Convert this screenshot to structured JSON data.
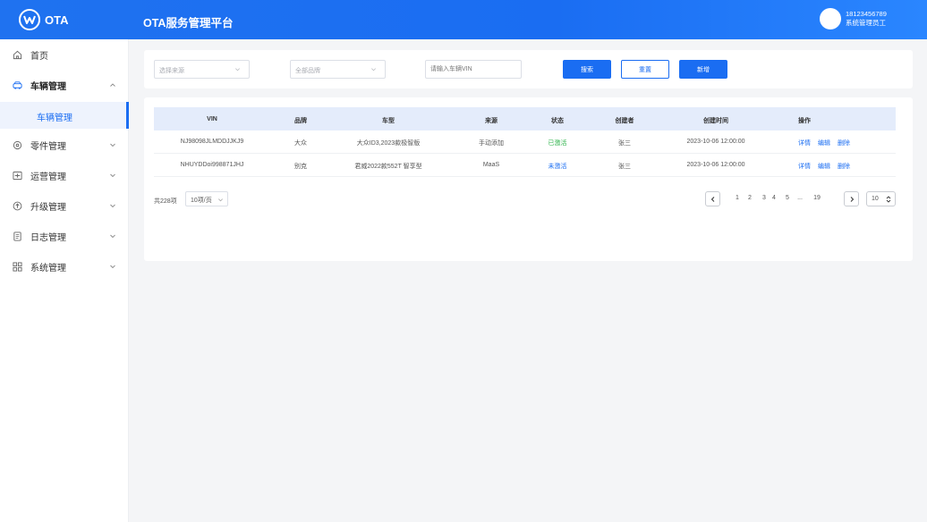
{
  "header": {
    "logo_text": "OTA",
    "app_title": "OTA服务管理平台",
    "user_phone": "18123456789",
    "user_role": "系统管理员工"
  },
  "sidebar": {
    "items": [
      {
        "label": "首页",
        "icon": "home-icon"
      },
      {
        "label": "车辆管理",
        "icon": "car-icon",
        "expanded": true
      },
      {
        "label": "零件管理",
        "icon": "parts-icon"
      },
      {
        "label": "运营管理",
        "icon": "operation-icon"
      },
      {
        "label": "升级管理",
        "icon": "upgrade-icon"
      },
      {
        "label": "日志管理",
        "icon": "log-icon"
      },
      {
        "label": "系统管理",
        "icon": "system-icon"
      }
    ],
    "active_subitem": "车辆管理"
  },
  "filters": {
    "source_placeholder": "选择来源",
    "brand_placeholder": "全部品牌",
    "vin_placeholder": "请输入车辆VIN",
    "search_label": "搜索",
    "reset_label": "重置",
    "add_label": "新增"
  },
  "table": {
    "columns": [
      "VIN",
      "品牌",
      "车型",
      "来源",
      "状态",
      "创建者",
      "创建时间",
      "操作"
    ],
    "rows": [
      {
        "vin": "NJ98098JLMDDJJKJ9",
        "brand": "大众",
        "model": "大众ID3,2023款极智版",
        "source": "手动添加",
        "status": "已激活",
        "creator": "张三",
        "created_at": "2023-10-06 12:00:00"
      },
      {
        "vin": "NHUYDDoi998871JHJ",
        "brand": "别克",
        "model": "君威2022款552T 智享型",
        "source": "MaaS",
        "status": "未激活",
        "creator": "张三",
        "created_at": "2023-10-06 12:00:00"
      }
    ],
    "actions": {
      "detail": "详情",
      "edit": "编辑",
      "delete": "删除"
    }
  },
  "pagination": {
    "total_text": "共228项",
    "page_size_text": "10项/页",
    "pages": [
      "1",
      "2",
      "3",
      "4",
      "5",
      "...",
      "19"
    ],
    "jump_value": "10"
  },
  "colors": {
    "primary": "#1a6df2",
    "active_status": "#2db34a",
    "inactive_status": "#1a6df2"
  }
}
